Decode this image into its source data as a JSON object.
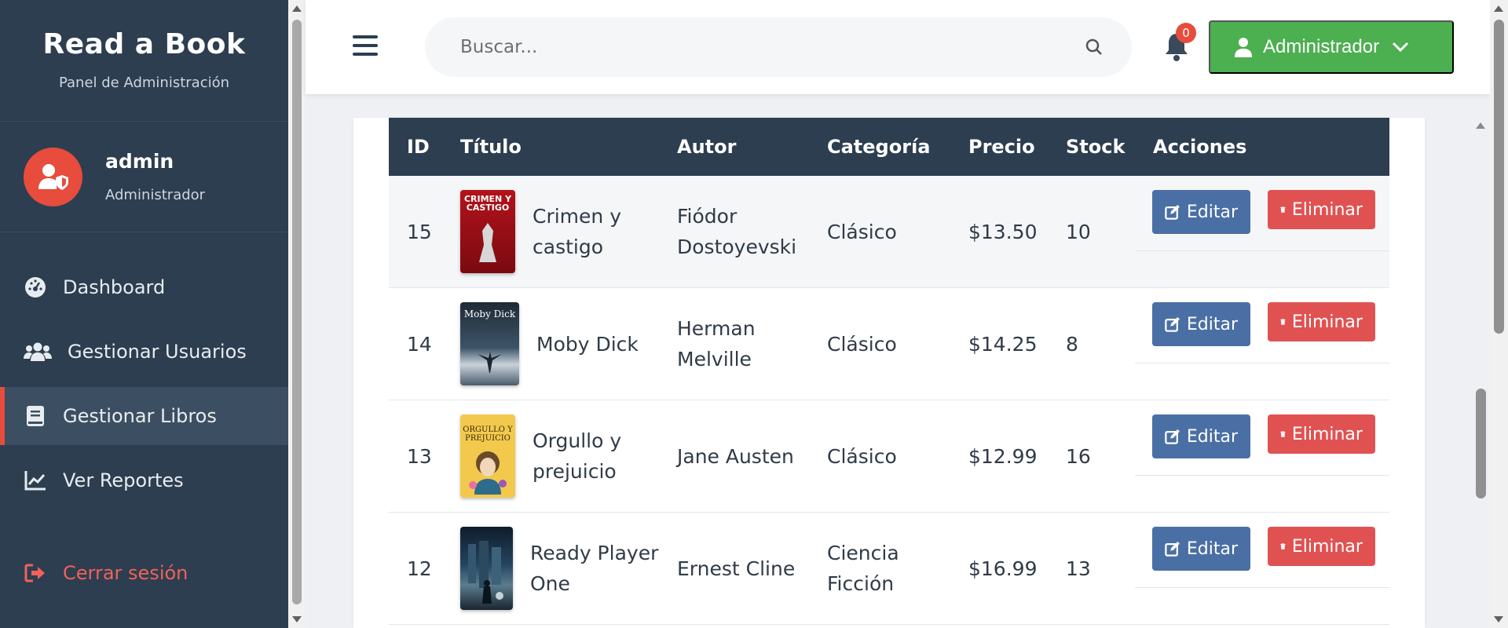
{
  "brand": {
    "title": "Read a Book",
    "subtitle": "Panel de Administración"
  },
  "user": {
    "name": "admin",
    "role": "Administrador"
  },
  "nav": [
    {
      "label": "Dashboard",
      "icon": "dashboard-icon"
    },
    {
      "label": "Gestionar Usuarios",
      "icon": "users-icon"
    },
    {
      "label": "Gestionar Libros",
      "icon": "book-icon",
      "active": true
    },
    {
      "label": "Ver Reportes",
      "icon": "chart-line-icon"
    }
  ],
  "logout": {
    "label": "Cerrar sesión"
  },
  "header": {
    "search_placeholder": "Buscar...",
    "notification_count": "0",
    "admin_label": "Administrador"
  },
  "colors": {
    "sidebar": "#2c3e50",
    "accent_red": "#e74c3c",
    "green": "#4caf50",
    "edit_blue": "#4a6fa5",
    "delete_red": "#e05252"
  },
  "table": {
    "headers": [
      "ID",
      "Título",
      "Autor",
      "Categoría",
      "Precio",
      "Stock",
      "Acciones"
    ],
    "edit_label": "Editar",
    "delete_label": "Eliminar",
    "rows": [
      {
        "id": "15",
        "title": "Crimen y castigo",
        "author": "Fiódor Dostoyevski",
        "category": "Clásico",
        "price": "$13.50",
        "stock": "10",
        "cover_text": "CRIMEN Y CASTIGO"
      },
      {
        "id": "14",
        "title": "Moby Dick",
        "author": "Herman Melville",
        "category": "Clásico",
        "price": "$14.25",
        "stock": "8",
        "cover_text": "Moby Dick"
      },
      {
        "id": "13",
        "title": "Orgullo y prejuicio",
        "author": "Jane Austen",
        "category": "Clásico",
        "price": "$12.99",
        "stock": "16",
        "cover_text": "ORGULLO Y PREJUICIO"
      },
      {
        "id": "12",
        "title": "Ready Player One",
        "author": "Ernest Cline",
        "category": "Ciencia Ficción",
        "price": "$16.99",
        "stock": "13",
        "cover_text": ""
      }
    ]
  }
}
